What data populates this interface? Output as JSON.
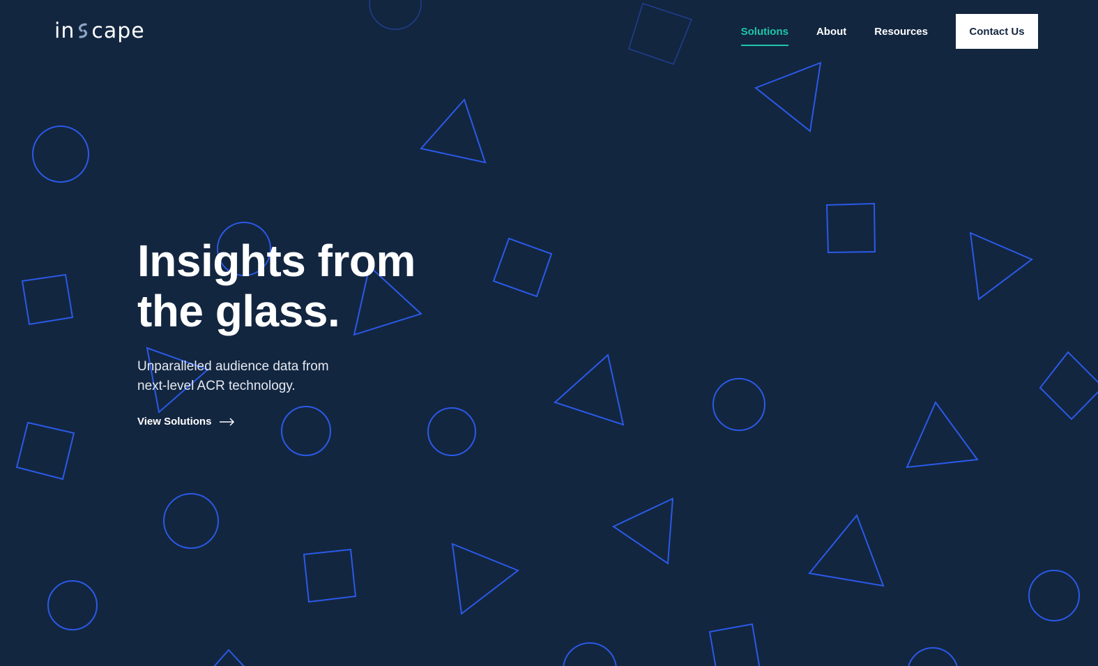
{
  "brand": {
    "logo_text_left": "in",
    "logo_text_right": "cape",
    "logo_icon": "s-swirl-logo-mark",
    "accent_color": "#1fc6a8",
    "background_color": "#132640",
    "shape_color": "#2a5ae8"
  },
  "nav": {
    "items": [
      {
        "label": "Solutions",
        "active": true
      },
      {
        "label": "About",
        "active": false
      },
      {
        "label": "Resources",
        "active": false
      }
    ],
    "contact_label": "Contact Us"
  },
  "hero": {
    "title_line1": "Insights from",
    "title_line2": "the glass.",
    "subtitle_line1": "Unparalleled audience data from",
    "subtitle_line2": "next-level ACR technology.",
    "cta_label": "View Solutions",
    "cta_icon": "arrow-right-icon"
  }
}
